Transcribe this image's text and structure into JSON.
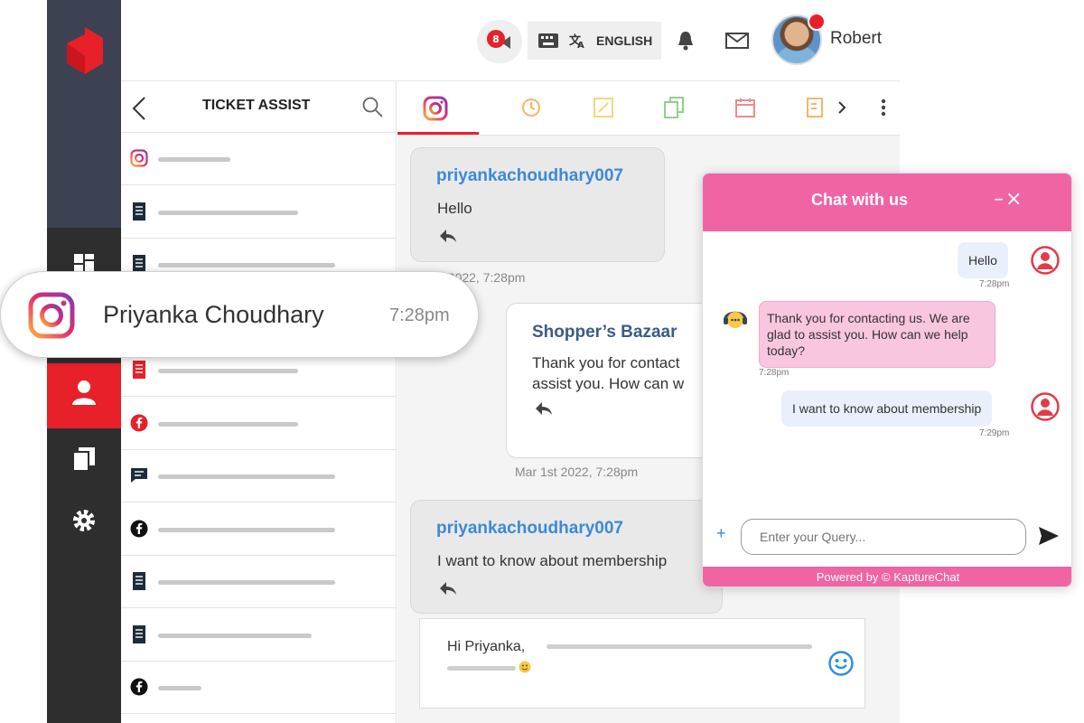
{
  "header": {
    "notification_count": "8",
    "language_label": "ENGLISH",
    "user_name": "Robert"
  },
  "ticket_panel": {
    "title": "TICKET ASSIST",
    "rows": [
      {
        "channel": "instagram-icon"
      },
      {
        "channel": "document-icon"
      },
      {
        "channel": "document-icon"
      },
      {
        "channel": "document-icon"
      },
      {
        "channel": "document-icon"
      },
      {
        "channel": "facebook-icon"
      },
      {
        "channel": "chat-icon"
      },
      {
        "channel": "facebook-icon"
      },
      {
        "channel": "document-icon"
      },
      {
        "channel": "document-icon"
      },
      {
        "channel": "facebook-icon"
      }
    ]
  },
  "highlight": {
    "name": "Priyanka Choudhary",
    "time": "7:28pm"
  },
  "conversation": {
    "msg1": {
      "user": "priyankachoudhary007",
      "text": "Hello",
      "timestamp": "t 2022, 7:28pm"
    },
    "msg2": {
      "user": "Shopper’s Bazaar",
      "line1": "Thank you for contact",
      "line2": "assist you. How can w",
      "timestamp": "Mar 1st 2022, 7:28pm"
    },
    "msg3": {
      "user": "priyankachoudhary007",
      "text": "I want to know about membership"
    },
    "composer_text": "Hi Priyanka,"
  },
  "chat_widget": {
    "title": "Chat with us",
    "controls": "–×",
    "messages": [
      {
        "from": "user",
        "text": "Hello",
        "time": "7:28pm"
      },
      {
        "from": "bot",
        "text": "Thank you for contacting us. We are glad to assist you. How can we help today?",
        "time": "7:28pm"
      },
      {
        "from": "user",
        "text": "I want to know about membership",
        "time": "7:29pm"
      }
    ],
    "input_placeholder": "Enter your Query...",
    "plus": "+",
    "footer": "Powered by © KaptureChat"
  },
  "colors": {
    "accent_red": "#e8202a",
    "chat_pink": "#f064a4",
    "link_blue": "#3d89d6",
    "rail_dark": "#2e2e2e"
  }
}
